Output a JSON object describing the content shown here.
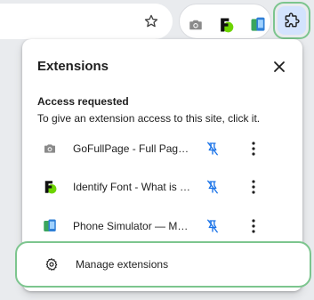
{
  "popup": {
    "title": "Extensions",
    "section_title": "Access requested",
    "section_description": "To give an extension access to this site, click it.",
    "extensions": [
      {
        "label": "GoFullPage - Full Page Screen Capture",
        "icon": "camera-icon"
      },
      {
        "label": "Identify Font - What is this font?",
        "icon": "identify-font-icon"
      },
      {
        "label": "Phone Simulator — Mobile Emulator",
        "icon": "phone-simulator-icon"
      }
    ],
    "manage_label": "Manage extensions"
  },
  "colors": {
    "highlight": "#7cc58e",
    "pin_blue": "#1a73e8",
    "puzzle_bg": "#d3e3fd"
  }
}
